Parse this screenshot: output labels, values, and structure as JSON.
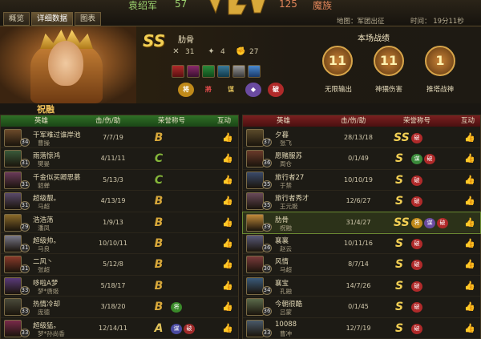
{
  "topbar": {
    "team_left": "袁绍军",
    "score_left": "57",
    "score_right": "125",
    "team_right": "魔族",
    "map_label": "地图：军团出征",
    "time_label": "时间： 19分11秒",
    "tabs": [
      {
        "label": "概览",
        "active": false
      },
      {
        "label": "详细数据",
        "active": true
      },
      {
        "label": "图表",
        "active": false
      }
    ]
  },
  "hero": {
    "grade": "SS",
    "name": "肋骨",
    "kills": "31",
    "deaths": "4",
    "assists": "27",
    "performance_title": "本场战绩",
    "medals": [
      {
        "number": "11",
        "label": "无限输出"
      },
      {
        "number": "11",
        "label": "神猥伤害"
      },
      {
        "number": "1",
        "label": "推塔战神"
      }
    ]
  },
  "team_caption": "祝融",
  "columns": {
    "hero": "英雄",
    "kda": "击/伤/助",
    "honor": "荣誉称号",
    "interact": "互动"
  },
  "left_team": [
    {
      "player": "干军难过谁岸池",
      "hero": "曹操",
      "level": "34",
      "kda": "7/7/19",
      "grade": "B",
      "tags": [],
      "color": "#6b4a2a"
    },
    {
      "player": "雨落惊鸿",
      "hero": "樊晏",
      "level": "31",
      "kda": "4/11/11",
      "grade": "C",
      "tags": [],
      "color": "#3a5a3a"
    },
    {
      "player": "千金似买卿思慕",
      "hero": "貂蝉",
      "level": "31",
      "kda": "5/13/3",
      "grade": "C",
      "tags": [],
      "color": "#6a3a5a"
    },
    {
      "player": "超级靓。",
      "hero": "马超",
      "level": "31",
      "kda": "4/13/19",
      "grade": "B",
      "tags": [],
      "color": "#5a4a6a"
    },
    {
      "player": "浩浩荡",
      "hero": "潘凤",
      "level": "29",
      "kda": "1/9/13",
      "grade": "B",
      "tags": [],
      "color": "#8a6a2a"
    },
    {
      "player": "超级帅。",
      "hero": "马良",
      "level": "31",
      "kda": "10/10/11",
      "grade": "B",
      "tags": [],
      "color": "#7a7a8a"
    },
    {
      "player": "二风丶",
      "hero": "张超",
      "level": "31",
      "kda": "5/12/8",
      "grade": "B",
      "tags": [],
      "color": "#8a3a2a"
    },
    {
      "player": "哆啦A梦",
      "hero": "梦*唐姬",
      "level": "33",
      "kda": "5/18/17",
      "grade": "B",
      "tags": [],
      "color": "#5a3a7a"
    },
    {
      "player": "热情冷却",
      "hero": "庞德",
      "level": "33",
      "kda": "3/18/20",
      "grade": "B",
      "tags": [
        {
          "text": "将",
          "color": "#3a8a2a"
        }
      ],
      "color": "#4a4a3a"
    },
    {
      "player": "超级猛。",
      "hero": "梦*孙尚香",
      "level": "33",
      "kda": "12/14/11",
      "grade": "A",
      "tags": [
        {
          "text": "谋",
          "color": "#4a4aa0"
        },
        {
          "text": "破",
          "color": "#a02a2a"
        }
      ],
      "color": "#7a2a4a"
    }
  ],
  "right_team": [
    {
      "player": "夕暮",
      "hero": "张飞",
      "level": "37",
      "kda": "28/13/18",
      "grade": "SS",
      "tags": [
        {
          "text": "破",
          "color": "#b02a2a"
        }
      ],
      "color": "#5a4a2a",
      "highlight": false
    },
    {
      "player": "愿赌服苏",
      "hero": "周仓",
      "level": "36",
      "kda": "0/1/49",
      "grade": "S",
      "tags": [
        {
          "text": "谋",
          "color": "#3a8a3a"
        },
        {
          "text": "破",
          "color": "#b02a2a"
        }
      ],
      "color": "#6a3a2a",
      "highlight": false
    },
    {
      "player": "旅行者27",
      "hero": "于禁",
      "level": "35",
      "kda": "10/10/19",
      "grade": "S",
      "tags": [
        {
          "text": "破",
          "color": "#b02a2a"
        }
      ],
      "color": "#3a4a6a",
      "highlight": false
    },
    {
      "player": "旅行者秀才",
      "hero": "王元姬",
      "level": "35",
      "kda": "12/6/27",
      "grade": "S",
      "tags": [
        {
          "text": "破",
          "color": "#b02a2a"
        }
      ],
      "color": "#6a4a5a",
      "highlight": false
    },
    {
      "player": "肋骨",
      "hero": "祝融",
      "level": "39",
      "kda": "31/4/27",
      "grade": "SS",
      "tags": [
        {
          "text": "将",
          "color": "#c08a1a"
        },
        {
          "text": "谋",
          "color": "#6a4aa0"
        },
        {
          "text": "破",
          "color": "#b02a2a"
        }
      ],
      "color": "#c08a3a",
      "highlight": true
    },
    {
      "player": "襄襄",
      "hero": "赵云",
      "level": "36",
      "kda": "10/11/16",
      "grade": "S",
      "tags": [
        {
          "text": "破",
          "color": "#b02a2a"
        }
      ],
      "color": "#5a5a7a",
      "highlight": false
    },
    {
      "player": "风情",
      "hero": "马超",
      "level": "30",
      "kda": "8/7/14",
      "grade": "S",
      "tags": [
        {
          "text": "破",
          "color": "#b02a2a"
        }
      ],
      "color": "#7a3a3a",
      "highlight": false
    },
    {
      "player": "襄宝",
      "hero": "孔融",
      "level": "34",
      "kda": "14/7/26",
      "grade": "S",
      "tags": [
        {
          "text": "破",
          "color": "#b02a2a"
        }
      ],
      "color": "#3a5a7a",
      "highlight": false
    },
    {
      "player": "今朝很酷",
      "hero": "吕蒙",
      "level": "36",
      "kda": "0/1/45",
      "grade": "S",
      "tags": [
        {
          "text": "破",
          "color": "#b02a2a"
        }
      ],
      "color": "#5a6a4a",
      "highlight": false
    },
    {
      "player": "10088",
      "hero": "曹冲",
      "level": "33",
      "kda": "12/7/19",
      "grade": "S",
      "tags": [
        {
          "text": "破",
          "color": "#b02a2a"
        }
      ],
      "color": "#4a5a6a",
      "highlight": false
    }
  ]
}
